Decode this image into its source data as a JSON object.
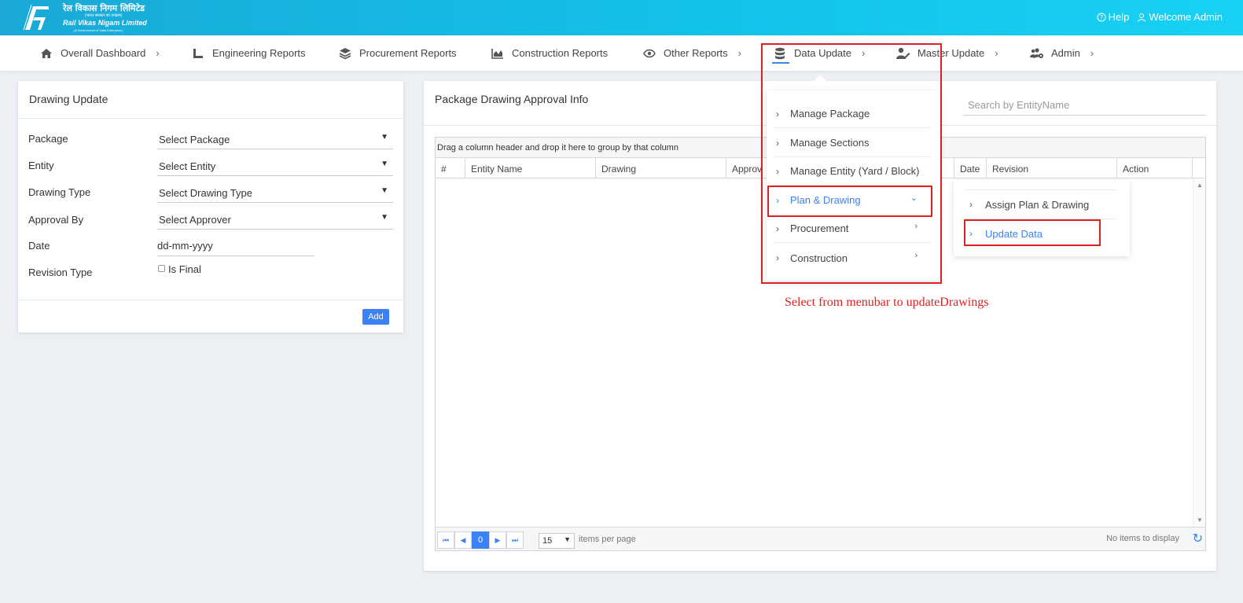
{
  "brand": {
    "hindi_name": "रेल विकास निगम लिमिटेड",
    "small_hindi": "(भारत सरकार का उपक्रम)",
    "english_name": "Rail Vikas Nigam Limited",
    "tagline": "(A Government of India Enterprise)"
  },
  "header": {
    "help_label": "Help",
    "welcome_label": "Welcome Admin"
  },
  "nav": {
    "items": [
      {
        "label": "Overall Dashboard",
        "icon": "home-icon",
        "has_chevron": true
      },
      {
        "label": "Engineering Reports",
        "icon": "ruler-icon",
        "has_chevron": false
      },
      {
        "label": "Procurement Reports",
        "icon": "layers-icon",
        "has_chevron": false
      },
      {
        "label": "Construction Reports",
        "icon": "area-chart-icon",
        "has_chevron": false
      },
      {
        "label": "Other Reports",
        "icon": "eye-icon",
        "has_chevron": true
      },
      {
        "label": "Data Update",
        "icon": "database-icon",
        "has_chevron": true
      },
      {
        "label": "Master Update",
        "icon": "user-edit-icon",
        "has_chevron": true
      },
      {
        "label": "Admin",
        "icon": "users-cog-icon",
        "has_chevron": true
      }
    ],
    "chevron": "›"
  },
  "drawing_update": {
    "title": "Drawing Update",
    "fields": [
      {
        "label": "Package",
        "value": "Select Package"
      },
      {
        "label": "Entity",
        "value": "Select Entity"
      },
      {
        "label": "Drawing Type",
        "value": "Select Drawing Type"
      },
      {
        "label": "Approval By",
        "value": "Select Approver"
      }
    ],
    "date_label": "Date",
    "date_value": "dd-mm-yyyy",
    "revision_label": "Revision Type",
    "is_final_label": "Is Final",
    "add_label": "Add"
  },
  "approval_info": {
    "title": "Package Drawing Approval Info",
    "search_placeholder": "Search by EntityName",
    "group_hint": "Drag a column header and drop it here to group by that column",
    "columns": [
      "#",
      "Entity Name",
      "Drawing",
      "Approv",
      "Date",
      "Revision",
      "Action"
    ],
    "pager": {
      "current_page": "0",
      "page_size": "15",
      "items_per_page": "items per page",
      "no_items": "No items to display"
    }
  },
  "data_update_menu": {
    "items": [
      {
        "label": "Manage Package",
        "expand": ""
      },
      {
        "label": "Manage Sections",
        "expand": ""
      },
      {
        "label": "Manage Entity (Yard / Block)",
        "expand": ""
      },
      {
        "label": "Plan & Drawing",
        "expand": "⌄",
        "active": true
      },
      {
        "label": "Procurement",
        "expand": "›"
      },
      {
        "label": "Construction",
        "expand": "›"
      }
    ],
    "submenu": [
      {
        "label": "Assign Plan & Drawing"
      },
      {
        "label": "Update Data",
        "active": true
      }
    ]
  },
  "annotation": "Select from menubar to updateDrawings",
  "colors": {
    "topbar": "#12c3ea",
    "accent": "#3b82f6",
    "highlight": "#e02020"
  }
}
